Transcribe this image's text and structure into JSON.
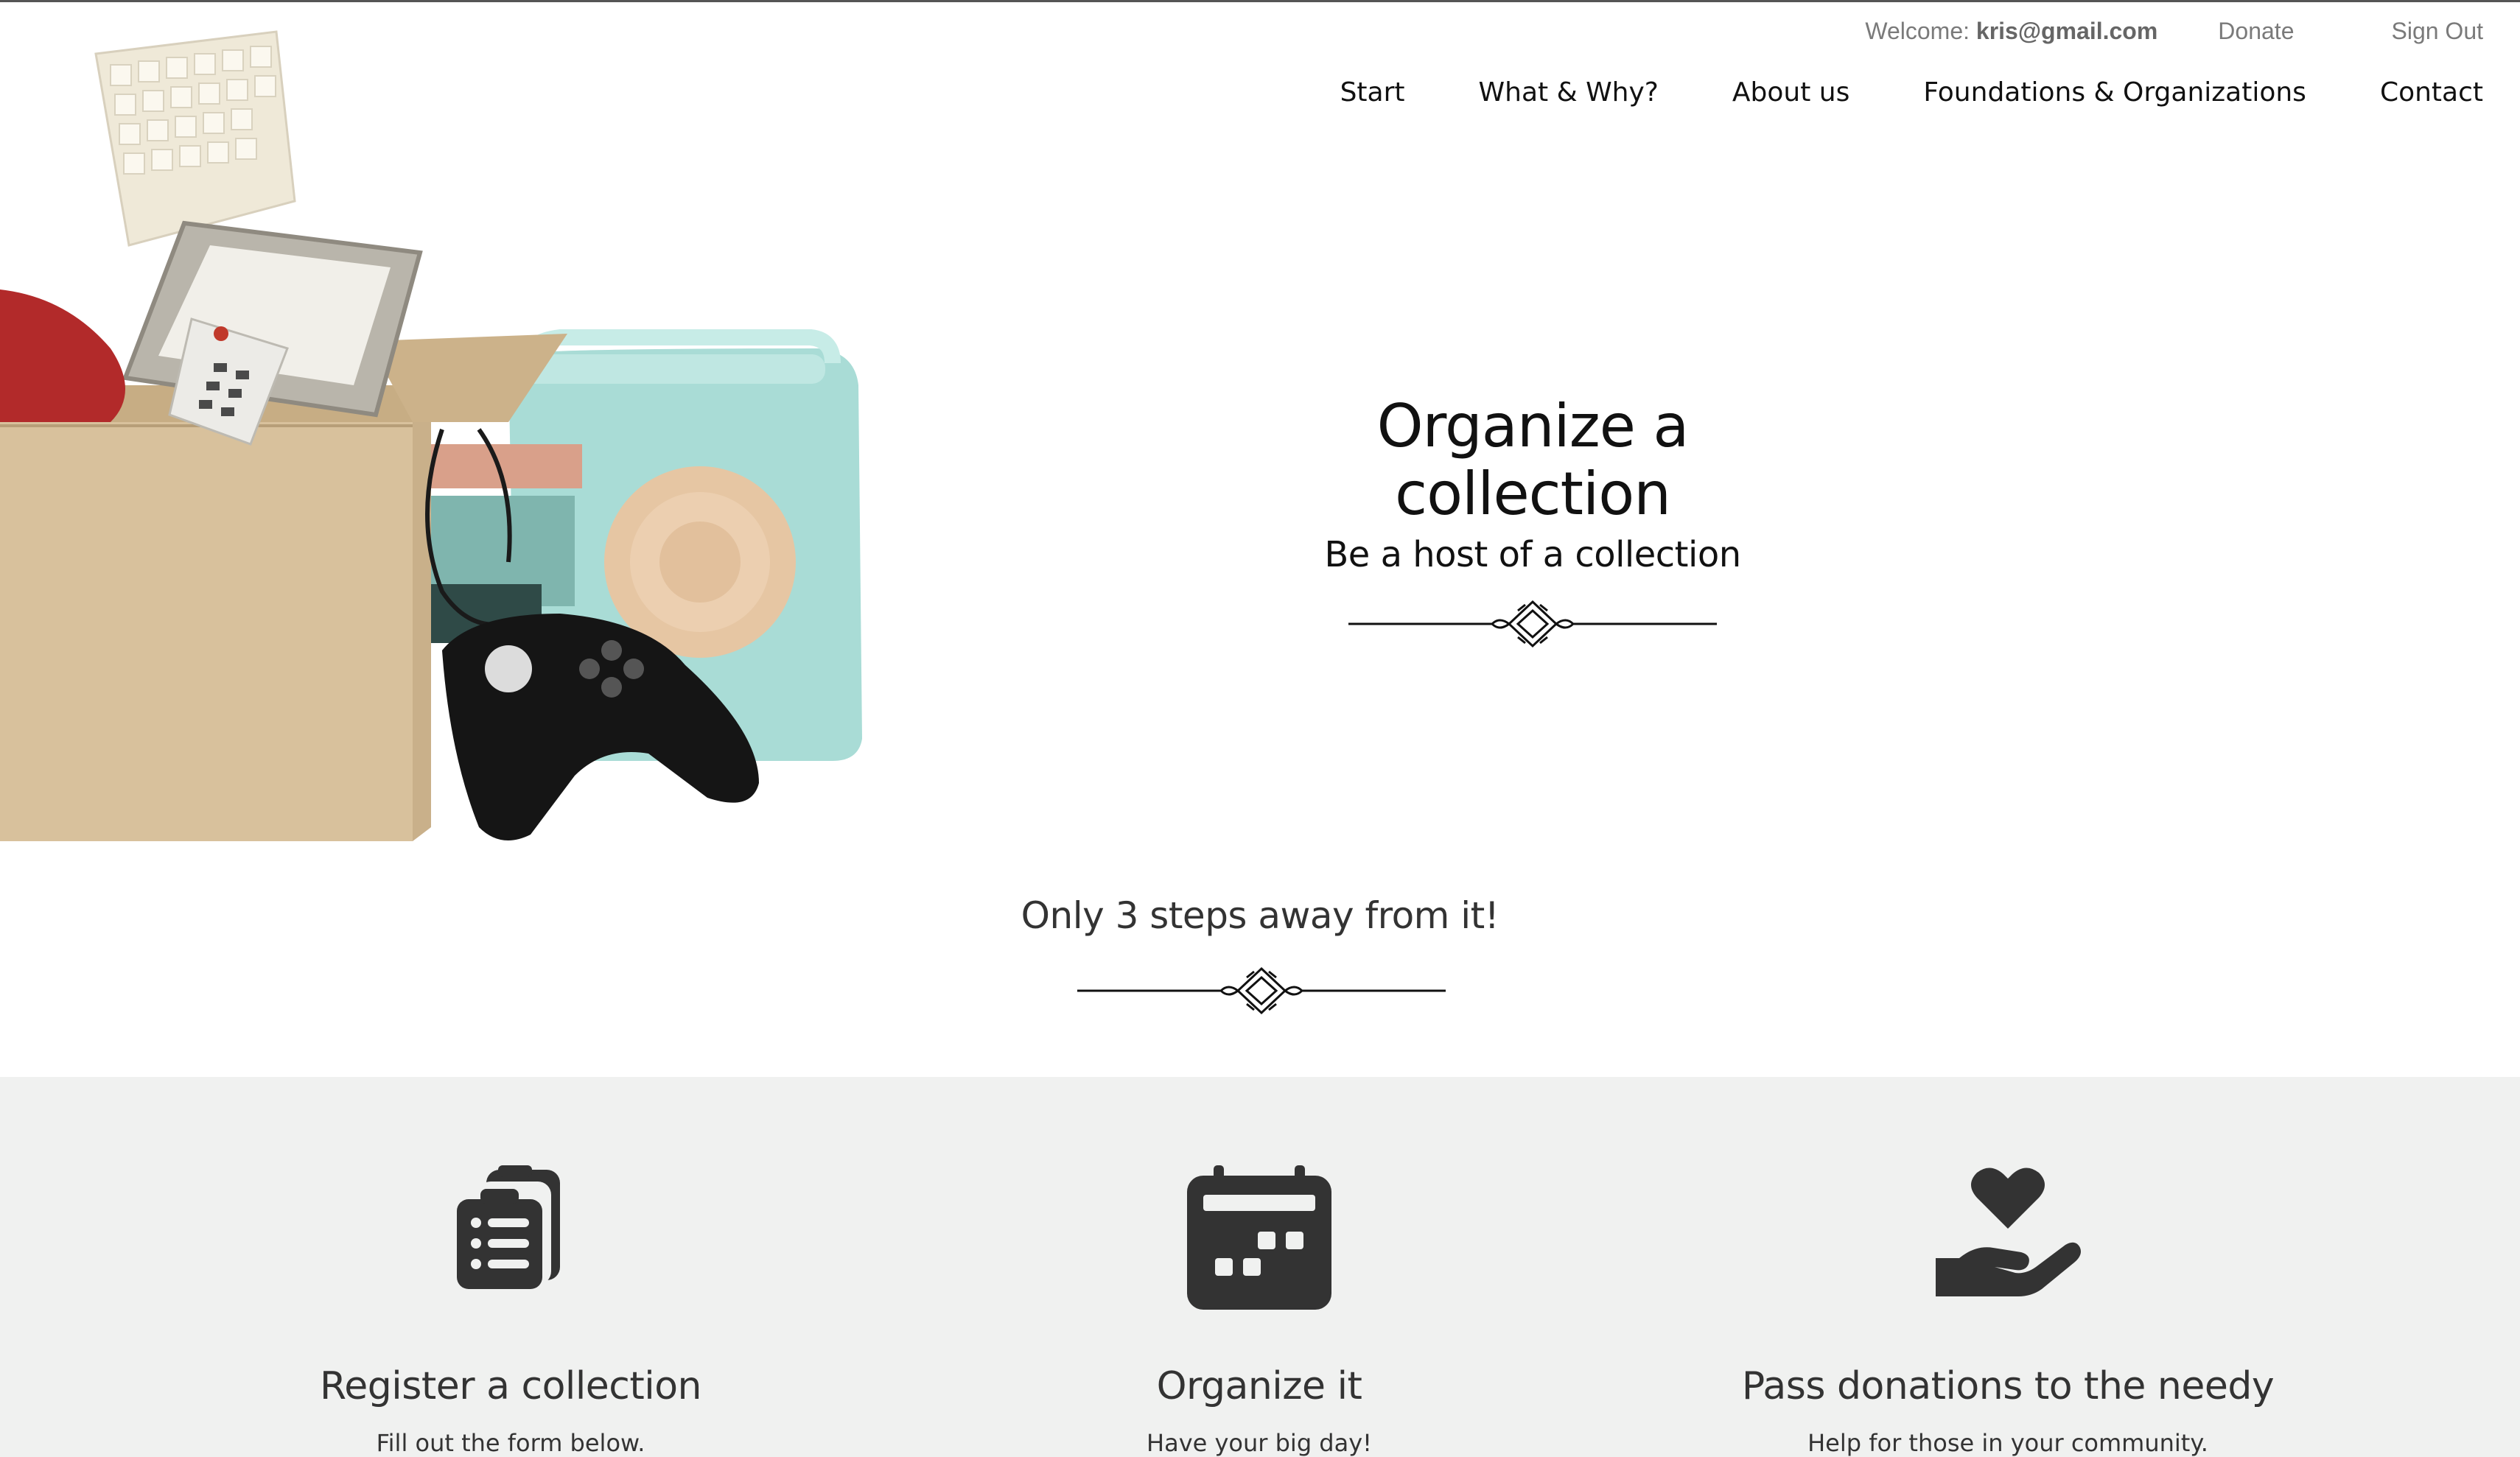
{
  "account": {
    "welcome_label": "Welcome:",
    "user_email": "kris@gmail.com",
    "donate_label": "Donate",
    "signout_label": "Sign Out"
  },
  "nav": {
    "items": [
      {
        "label": "Start"
      },
      {
        "label": "What & Why?"
      },
      {
        "label": "About us"
      },
      {
        "label": "Foundations & Organizations"
      },
      {
        "label": "Contact"
      }
    ]
  },
  "hero": {
    "title": "Organize a collection",
    "subtitle": "Be a host of a collection"
  },
  "steps_section": {
    "title": "Only 3 steps away from it!",
    "steps": [
      {
        "icon": "clipboard-list-icon",
        "title": "Register a collection",
        "desc": "Fill out the form below."
      },
      {
        "icon": "calendar-icon",
        "title": "Organize it",
        "desc": "Have your big day!"
      },
      {
        "icon": "hand-holding-heart-icon",
        "title": "Pass donations to the needy",
        "desc": "Help for those in your community."
      }
    ]
  },
  "colors": {
    "panel_bg": "#f0f1f0",
    "icon_fill": "#333333",
    "text": "#111111"
  }
}
